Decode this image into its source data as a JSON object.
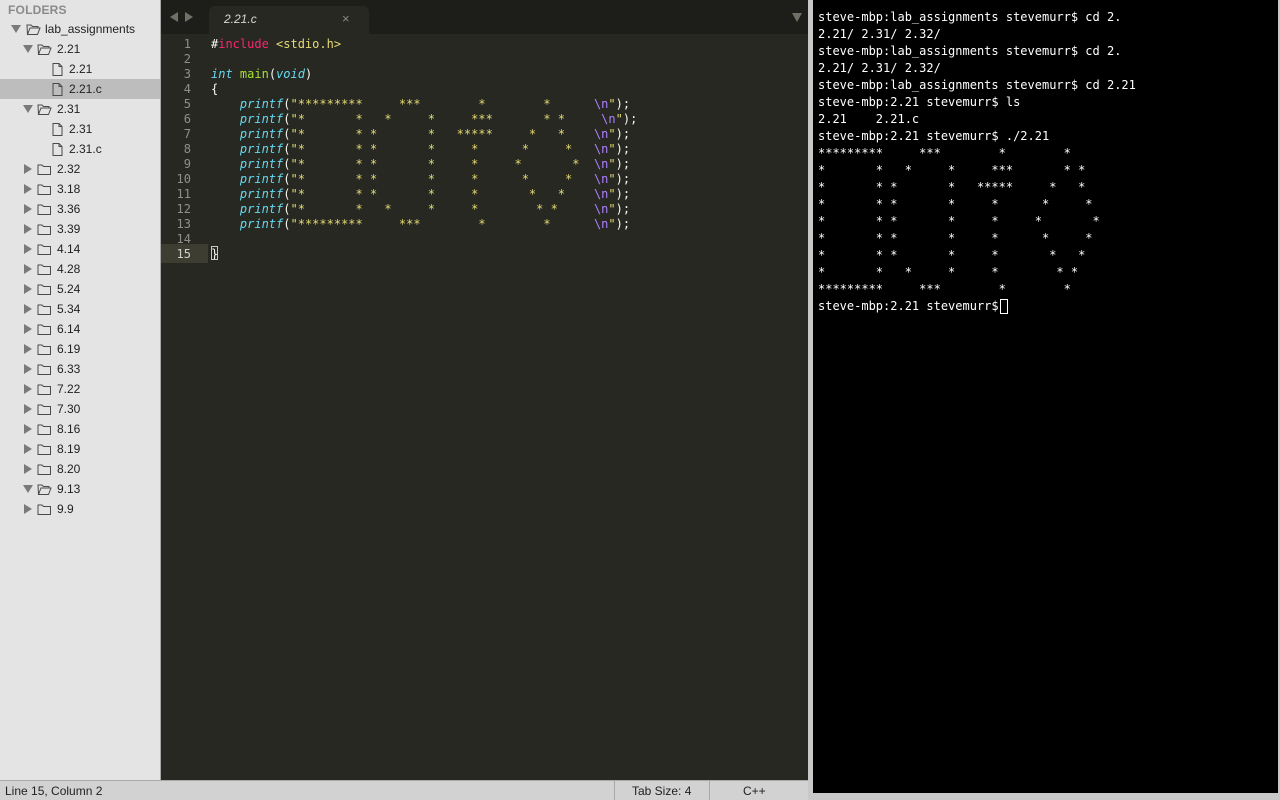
{
  "sidebar": {
    "header": "FOLDERS",
    "root": "lab_assignments",
    "items": [
      {
        "label": "2.21",
        "type": "folder",
        "open": true,
        "level": 1
      },
      {
        "label": "2.21",
        "type": "file",
        "level": 2
      },
      {
        "label": "2.21.c",
        "type": "file",
        "level": 2,
        "selected": true
      },
      {
        "label": "2.31",
        "type": "folder",
        "open": true,
        "level": 1
      },
      {
        "label": "2.31",
        "type": "file",
        "level": 2
      },
      {
        "label": "2.31.c",
        "type": "file",
        "level": 2
      },
      {
        "label": "2.32",
        "type": "folder",
        "open": false,
        "level": 1
      },
      {
        "label": "3.18",
        "type": "folder",
        "open": false,
        "level": 1
      },
      {
        "label": "3.36",
        "type": "folder",
        "open": false,
        "level": 1
      },
      {
        "label": "3.39",
        "type": "folder",
        "open": false,
        "level": 1
      },
      {
        "label": "4.14",
        "type": "folder",
        "open": false,
        "level": 1
      },
      {
        "label": "4.28",
        "type": "folder",
        "open": false,
        "level": 1
      },
      {
        "label": "5.24",
        "type": "folder",
        "open": false,
        "level": 1
      },
      {
        "label": "5.34",
        "type": "folder",
        "open": false,
        "level": 1
      },
      {
        "label": "6.14",
        "type": "folder",
        "open": false,
        "level": 1
      },
      {
        "label": "6.19",
        "type": "folder",
        "open": false,
        "level": 1
      },
      {
        "label": "6.33",
        "type": "folder",
        "open": false,
        "level": 1
      },
      {
        "label": "7.22",
        "type": "folder",
        "open": false,
        "level": 1
      },
      {
        "label": "7.30",
        "type": "folder",
        "open": false,
        "level": 1
      },
      {
        "label": "8.16",
        "type": "folder",
        "open": false,
        "level": 1
      },
      {
        "label": "8.19",
        "type": "folder",
        "open": false,
        "level": 1
      },
      {
        "label": "8.20",
        "type": "folder",
        "open": false,
        "level": 1
      },
      {
        "label": "9.13",
        "type": "folder",
        "open": true,
        "level": 1
      },
      {
        "label": "9.9",
        "type": "folder",
        "open": false,
        "level": 1
      }
    ]
  },
  "editor": {
    "tab_title": "2.21.c",
    "tab_close": "×",
    "code": [
      {
        "n": "1",
        "parts": [
          {
            "t": "#",
            "c": "white"
          },
          {
            "t": "include",
            "c": "pink"
          },
          {
            "t": " <stdio.h>",
            "c": "yellow"
          }
        ]
      },
      {
        "n": "2",
        "parts": []
      },
      {
        "n": "3",
        "parts": [
          {
            "t": "int",
            "c": "blue"
          },
          {
            "t": " ",
            "c": "white"
          },
          {
            "t": "main",
            "c": "green"
          },
          {
            "t": "(",
            "c": "white"
          },
          {
            "t": "void",
            "c": "blue"
          },
          {
            "t": ")",
            "c": "white"
          }
        ]
      },
      {
        "n": "4",
        "parts": [
          {
            "t": "{",
            "c": "white"
          }
        ]
      },
      {
        "n": "5",
        "parts": [
          {
            "t": "    ",
            "c": "white"
          },
          {
            "t": "printf",
            "c": "blue"
          },
          {
            "t": "(",
            "c": "white"
          },
          {
            "t": "\"*********     ***        *        *      ",
            "c": "yellow"
          },
          {
            "t": "\\n",
            "c": "purple"
          },
          {
            "t": "\"",
            "c": "yellow"
          },
          {
            "t": ");",
            "c": "white"
          }
        ]
      },
      {
        "n": "6",
        "parts": [
          {
            "t": "    ",
            "c": "white"
          },
          {
            "t": "printf",
            "c": "blue"
          },
          {
            "t": "(",
            "c": "white"
          },
          {
            "t": "\"*       *   *     *     ***       * *     ",
            "c": "yellow"
          },
          {
            "t": "\\n",
            "c": "purple"
          },
          {
            "t": "\"",
            "c": "yellow"
          },
          {
            "t": ");",
            "c": "white"
          }
        ]
      },
      {
        "n": "7",
        "parts": [
          {
            "t": "    ",
            "c": "white"
          },
          {
            "t": "printf",
            "c": "blue"
          },
          {
            "t": "(",
            "c": "white"
          },
          {
            "t": "\"*       * *       *   *****     *   *    ",
            "c": "yellow"
          },
          {
            "t": "\\n",
            "c": "purple"
          },
          {
            "t": "\"",
            "c": "yellow"
          },
          {
            "t": ");",
            "c": "white"
          }
        ]
      },
      {
        "n": "8",
        "parts": [
          {
            "t": "    ",
            "c": "white"
          },
          {
            "t": "printf",
            "c": "blue"
          },
          {
            "t": "(",
            "c": "white"
          },
          {
            "t": "\"*       * *       *     *      *     *   ",
            "c": "yellow"
          },
          {
            "t": "\\n",
            "c": "purple"
          },
          {
            "t": "\"",
            "c": "yellow"
          },
          {
            "t": ");",
            "c": "white"
          }
        ]
      },
      {
        "n": "9",
        "parts": [
          {
            "t": "    ",
            "c": "white"
          },
          {
            "t": "printf",
            "c": "blue"
          },
          {
            "t": "(",
            "c": "white"
          },
          {
            "t": "\"*       * *       *     *     *       *  ",
            "c": "yellow"
          },
          {
            "t": "\\n",
            "c": "purple"
          },
          {
            "t": "\"",
            "c": "yellow"
          },
          {
            "t": ");",
            "c": "white"
          }
        ]
      },
      {
        "n": "10",
        "parts": [
          {
            "t": "    ",
            "c": "white"
          },
          {
            "t": "printf",
            "c": "blue"
          },
          {
            "t": "(",
            "c": "white"
          },
          {
            "t": "\"*       * *       *     *      *     *   ",
            "c": "yellow"
          },
          {
            "t": "\\n",
            "c": "purple"
          },
          {
            "t": "\"",
            "c": "yellow"
          },
          {
            "t": ");",
            "c": "white"
          }
        ]
      },
      {
        "n": "11",
        "parts": [
          {
            "t": "    ",
            "c": "white"
          },
          {
            "t": "printf",
            "c": "blue"
          },
          {
            "t": "(",
            "c": "white"
          },
          {
            "t": "\"*       * *       *     *       *   *    ",
            "c": "yellow"
          },
          {
            "t": "\\n",
            "c": "purple"
          },
          {
            "t": "\"",
            "c": "yellow"
          },
          {
            "t": ");",
            "c": "white"
          }
        ]
      },
      {
        "n": "12",
        "parts": [
          {
            "t": "    ",
            "c": "white"
          },
          {
            "t": "printf",
            "c": "blue"
          },
          {
            "t": "(",
            "c": "white"
          },
          {
            "t": "\"*       *   *     *     *        * *     ",
            "c": "yellow"
          },
          {
            "t": "\\n",
            "c": "purple"
          },
          {
            "t": "\"",
            "c": "yellow"
          },
          {
            "t": ");",
            "c": "white"
          }
        ]
      },
      {
        "n": "13",
        "parts": [
          {
            "t": "    ",
            "c": "white"
          },
          {
            "t": "printf",
            "c": "blue"
          },
          {
            "t": "(",
            "c": "white"
          },
          {
            "t": "\"*********     ***        *        *      ",
            "c": "yellow"
          },
          {
            "t": "\\n",
            "c": "purple"
          },
          {
            "t": "\"",
            "c": "yellow"
          },
          {
            "t": ");",
            "c": "white"
          }
        ]
      },
      {
        "n": "14",
        "parts": []
      },
      {
        "n": "15",
        "parts": [
          {
            "t": "}",
            "c": "white"
          }
        ]
      }
    ]
  },
  "terminal": {
    "lines": [
      "steve-mbp:lab_assignments stevemurr$ cd 2.",
      "2.21/ 2.31/ 2.32/",
      "steve-mbp:lab_assignments stevemurr$ cd 2.",
      "2.21/ 2.31/ 2.32/",
      "steve-mbp:lab_assignments stevemurr$ cd 2.21",
      "steve-mbp:2.21 stevemurr$ ls",
      "2.21    2.21.c",
      "steve-mbp:2.21 stevemurr$ ./2.21",
      "*********     ***        *        *",
      "*       *   *     *     ***       * *",
      "*       * *       *   *****     *   *",
      "*       * *       *     *      *     *",
      "*       * *       *     *     *       *",
      "*       * *       *     *      *     *",
      "*       * *       *     *       *   *",
      "*       *   *     *     *        * *",
      "*********     ***        *        *",
      "steve-mbp:2.21 stevemurr$ "
    ]
  },
  "status": {
    "position": "Line 15, Column 2",
    "tab_size": "Tab Size: 4",
    "syntax": "C++"
  }
}
